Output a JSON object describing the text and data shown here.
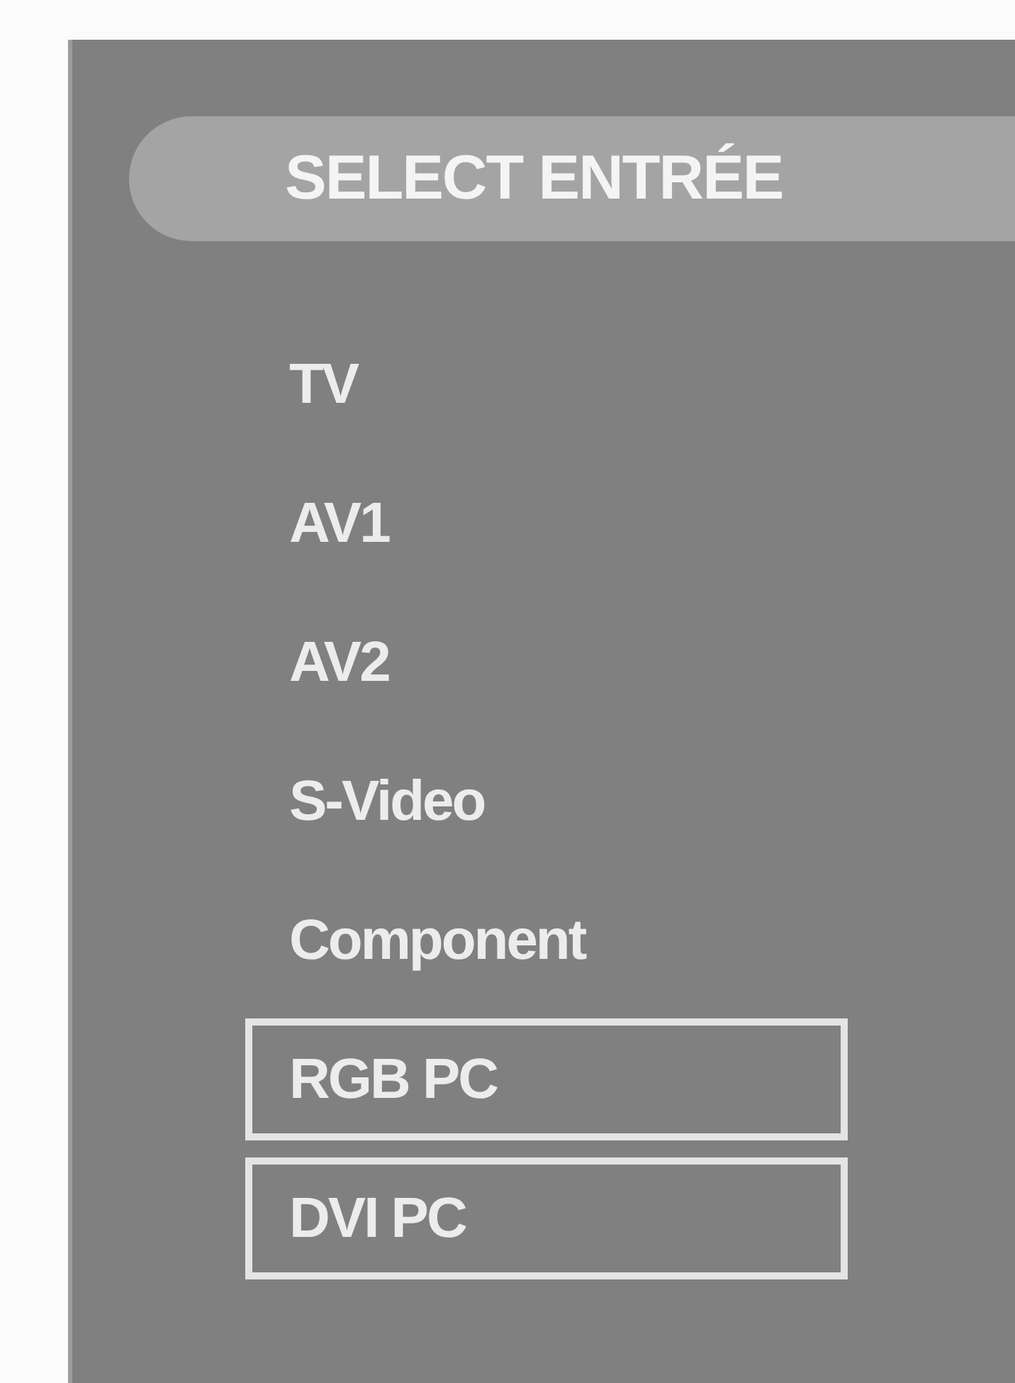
{
  "menu": {
    "title": "SELECT ENTRÉE",
    "items": [
      {
        "label": "TV",
        "boxed": false
      },
      {
        "label": "AV1",
        "boxed": false
      },
      {
        "label": "AV2",
        "boxed": false
      },
      {
        "label": "S-Video",
        "boxed": false
      },
      {
        "label": "Component",
        "boxed": false
      },
      {
        "label": "RGB PC",
        "boxed": true
      },
      {
        "label": "DVI PC",
        "boxed": true
      }
    ]
  }
}
